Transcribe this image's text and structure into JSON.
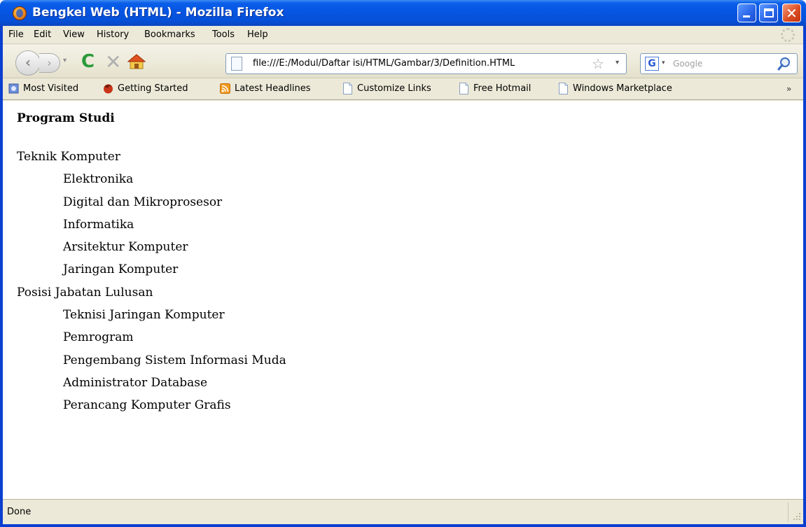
{
  "window": {
    "title": "Bengkel Web (HTML) - Mozilla Firefox",
    "close_glyph": "✕"
  },
  "menu": {
    "items": [
      "File",
      "Edit",
      "View",
      "History",
      "Bookmarks",
      "Tools",
      "Help"
    ]
  },
  "navigation": {
    "back_glyph": "‹",
    "forward_glyph": "›",
    "history_dropdown_glyph": "▾",
    "reload_glyph": "C",
    "stop_glyph": "✕",
    "url": "file:///E:/Modul/Daftar isi/HTML/Gambar/3/Definition.HTML",
    "star_glyph": "☆",
    "url_dropdown_glyph": "▾",
    "search": {
      "engine_letter": "G",
      "engine_dropdown_glyph": "▾",
      "placeholder": "Google"
    }
  },
  "bookmarks": {
    "items": [
      {
        "label": "Most Visited",
        "icon": "most-visited-icon"
      },
      {
        "label": "Getting Started",
        "icon": "firefox-icon"
      },
      {
        "label": "Latest Headlines",
        "icon": "rss-icon"
      },
      {
        "label": "Customize Links",
        "icon": "page-icon"
      },
      {
        "label": "Free Hotmail",
        "icon": "page-icon"
      },
      {
        "label": "Windows Marketplace",
        "icon": "page-icon"
      }
    ],
    "overflow_glyph": "»"
  },
  "content": {
    "heading": "Program Studi",
    "definitions": [
      {
        "term": "Teknik Komputer",
        "items": [
          "Elektronika",
          "Digital dan Mikroprosesor",
          "Informatika",
          "Arsitektur Komputer",
          "Jaringan Komputer"
        ]
      },
      {
        "term": "Posisi Jabatan Lulusan",
        "items": [
          "Teknisi Jaringan Komputer",
          "Pemrogram",
          "Pengembang Sistem Informasi Muda",
          "Administrator Database",
          "Perancang Komputer Grafis"
        ]
      }
    ]
  },
  "status": {
    "text": "Done"
  },
  "colors": {
    "titlebar": "#0655e3",
    "chrome": "#ece9d8",
    "close_button": "#dc4e24",
    "reload": "#2a9a3a"
  }
}
